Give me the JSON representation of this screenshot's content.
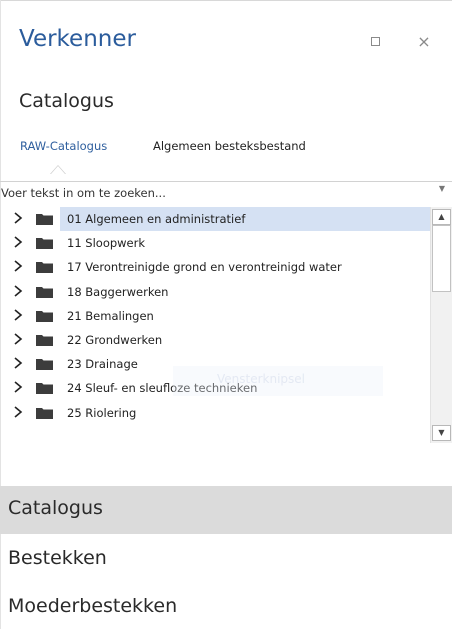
{
  "panel": {
    "title": "Verkenner",
    "maximize_icon": "maximize-icon",
    "close_label": "×"
  },
  "section": {
    "heading": "Catalogus"
  },
  "tabs": [
    {
      "label": "RAW-Catalogus",
      "active": true
    },
    {
      "label": "Algemeen besteksbestand",
      "active": false
    }
  ],
  "search": {
    "placeholder": "Voer tekst in om te zoeken...",
    "value": "",
    "dropdown_icon": "chevron-down-icon"
  },
  "tree": {
    "items": [
      {
        "label": "01  Algemeen en administratief",
        "selected": true
      },
      {
        "label": "11  Sloopwerk"
      },
      {
        "label": "17  Verontreinigde grond en verontreinigd water"
      },
      {
        "label": "18  Baggerwerken"
      },
      {
        "label": "21  Bemalingen"
      },
      {
        "label": "22  Grondwerken"
      },
      {
        "label": "23  Drainage"
      },
      {
        "label": "24  Sleuf- en sleufloze technieken"
      },
      {
        "label": "25  Riolering"
      }
    ],
    "expand_icon": "chevron-right-icon",
    "item_icon": "folder-icon"
  },
  "scrollbar": {
    "up": "▲",
    "down": "▼"
  },
  "ghost_tooltip": "Vensterknipsel",
  "nav": [
    {
      "label": "Catalogus",
      "active": true
    },
    {
      "label": "Bestekken",
      "active": false
    },
    {
      "label": "Moederbestekken",
      "active": false
    }
  ],
  "colors": {
    "accent": "#2b5c9c",
    "selection": "#d5e1f3",
    "nav_active": "#dbdbdb"
  }
}
